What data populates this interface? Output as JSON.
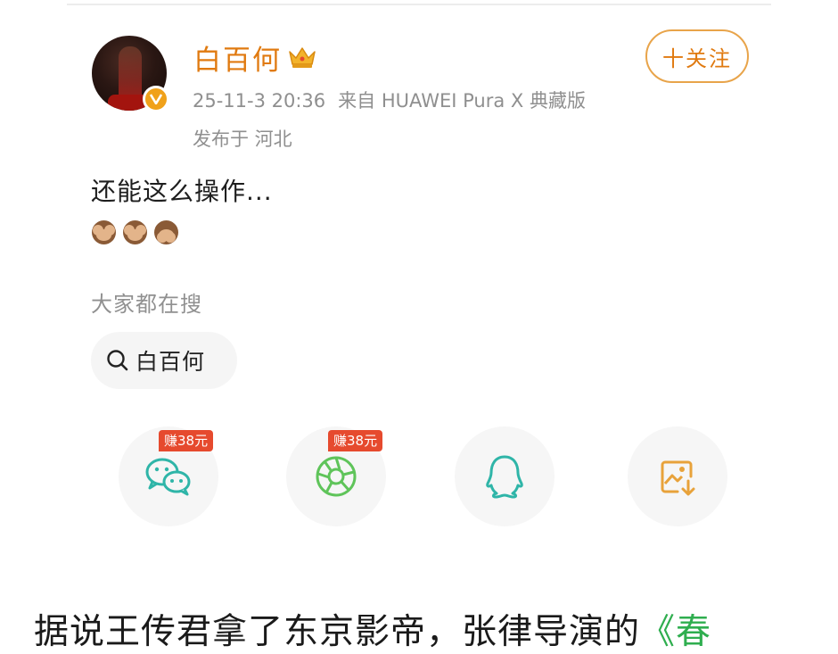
{
  "post": {
    "username": "白百何",
    "follow_label": "十关注",
    "timestamp": "25-11-3 20:36",
    "source": "来自 HUAWEI Pura X 典藏版",
    "location": "发布于 河北",
    "text": "还能这么操作...",
    "emojis": [
      "see-no-evil-monkey",
      "see-no-evil-monkey",
      "speak-no-evil-monkey"
    ]
  },
  "search": {
    "label": "大家都在搜",
    "chip": "白百何"
  },
  "share": {
    "items": [
      {
        "icon": "wechat-icon",
        "reward": "赚38元",
        "color": "#2fb5a8"
      },
      {
        "icon": "moments-icon",
        "reward": "赚38元",
        "color": "#5fc45a"
      },
      {
        "icon": "qq-icon",
        "reward": "",
        "color": "#2fb5a8"
      },
      {
        "icon": "save-image-icon",
        "reward": "",
        "color": "#e8a23a"
      }
    ]
  },
  "caption": {
    "text": "据说王传君拿了东京影帝，张律导演的",
    "highlight": "《春"
  },
  "colors": {
    "accent": "#e07a10",
    "reward": "#e64a2e",
    "muted": "#8f8f8f"
  }
}
